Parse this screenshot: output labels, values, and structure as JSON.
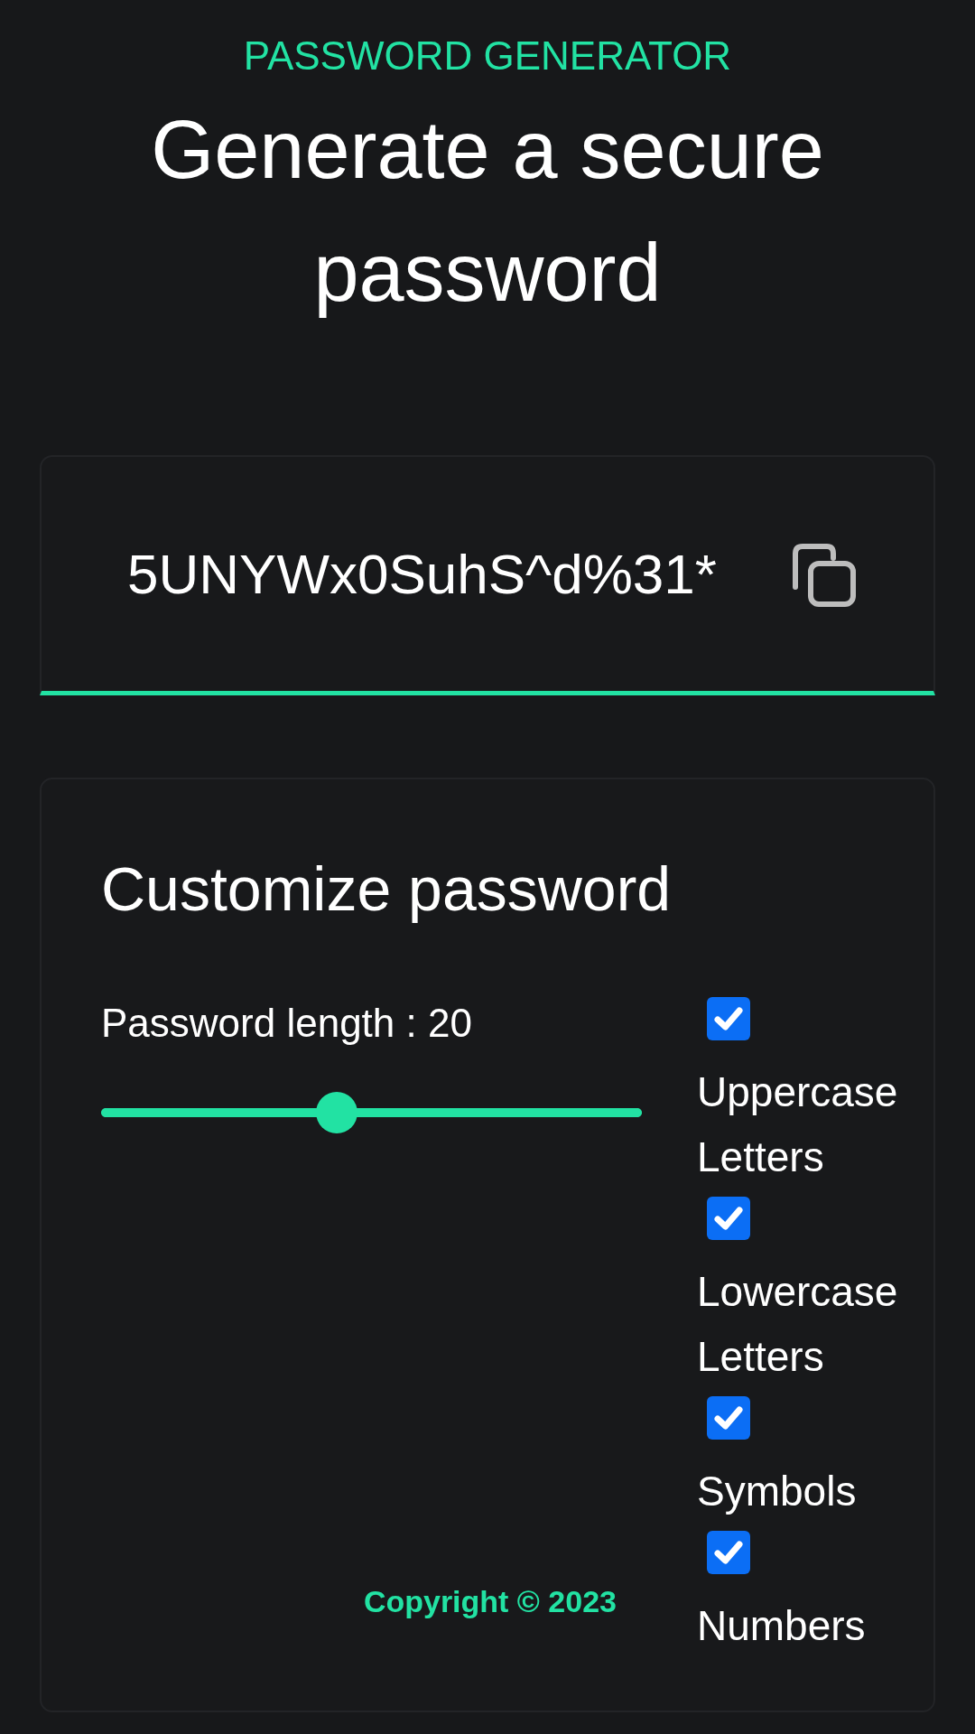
{
  "header": {
    "eyebrow": "PASSWORD GENERATOR",
    "title": "Generate a secure password"
  },
  "password_card": {
    "password": "5UNYWx0SuhS^d%31*"
  },
  "customize": {
    "heading": "Customize password",
    "length_label": "Password length : 20",
    "slider": {
      "level": 0.43
    },
    "options": [
      {
        "label": "Uppercase Letters",
        "checked": true
      },
      {
        "label": "Lowercase Letters",
        "checked": true
      },
      {
        "label": "Symbols",
        "checked": true
      },
      {
        "label": "Numbers",
        "checked": true
      }
    ],
    "copyright": "Copyright © 2023"
  }
}
